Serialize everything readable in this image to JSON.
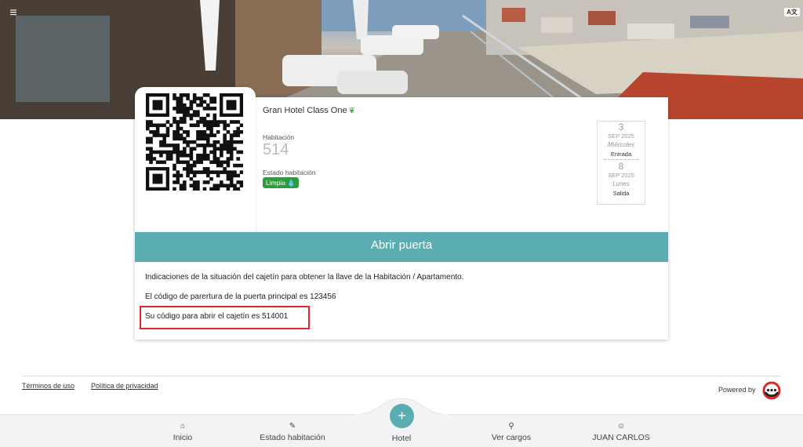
{
  "hero": {
    "menu_icon": "≡",
    "translate_icon": "A文"
  },
  "hotel": {
    "name": "Gran Hotel Class One",
    "room_label": "Habitación",
    "room_number": "514",
    "status_label": "Estado habitación",
    "status_value": "Limpia"
  },
  "dates": {
    "checkin": {
      "day": "3",
      "month": "SEP 2025",
      "weekday": "Miércoles",
      "tag": "Entrada"
    },
    "checkout": {
      "day": "8",
      "month": "SEP 2025",
      "weekday": "Lunes",
      "tag": "Salida"
    }
  },
  "door": {
    "title": "Abrir puerta",
    "line1": "Indicaciones de la situación del cajetín para obtener la llave de la Habitación / Apartamento.",
    "line2": "El código de parertura de la puerta principal es 123456",
    "line3": "Su código para abrir el cajetín es 514001"
  },
  "footer": {
    "terms": "Términos de uso",
    "privacy": "Política de privacidad",
    "powered_by": "Powered by"
  },
  "nav": {
    "home": "Inicio",
    "room_status": "Estado habitación",
    "hotel": "Hotel",
    "charges": "Ver cargos",
    "user": "JUAN CARLOS"
  },
  "colors": {
    "accent": "#5aaeb2",
    "badge": "#2e9c3e",
    "highlight": "#e3262c"
  }
}
